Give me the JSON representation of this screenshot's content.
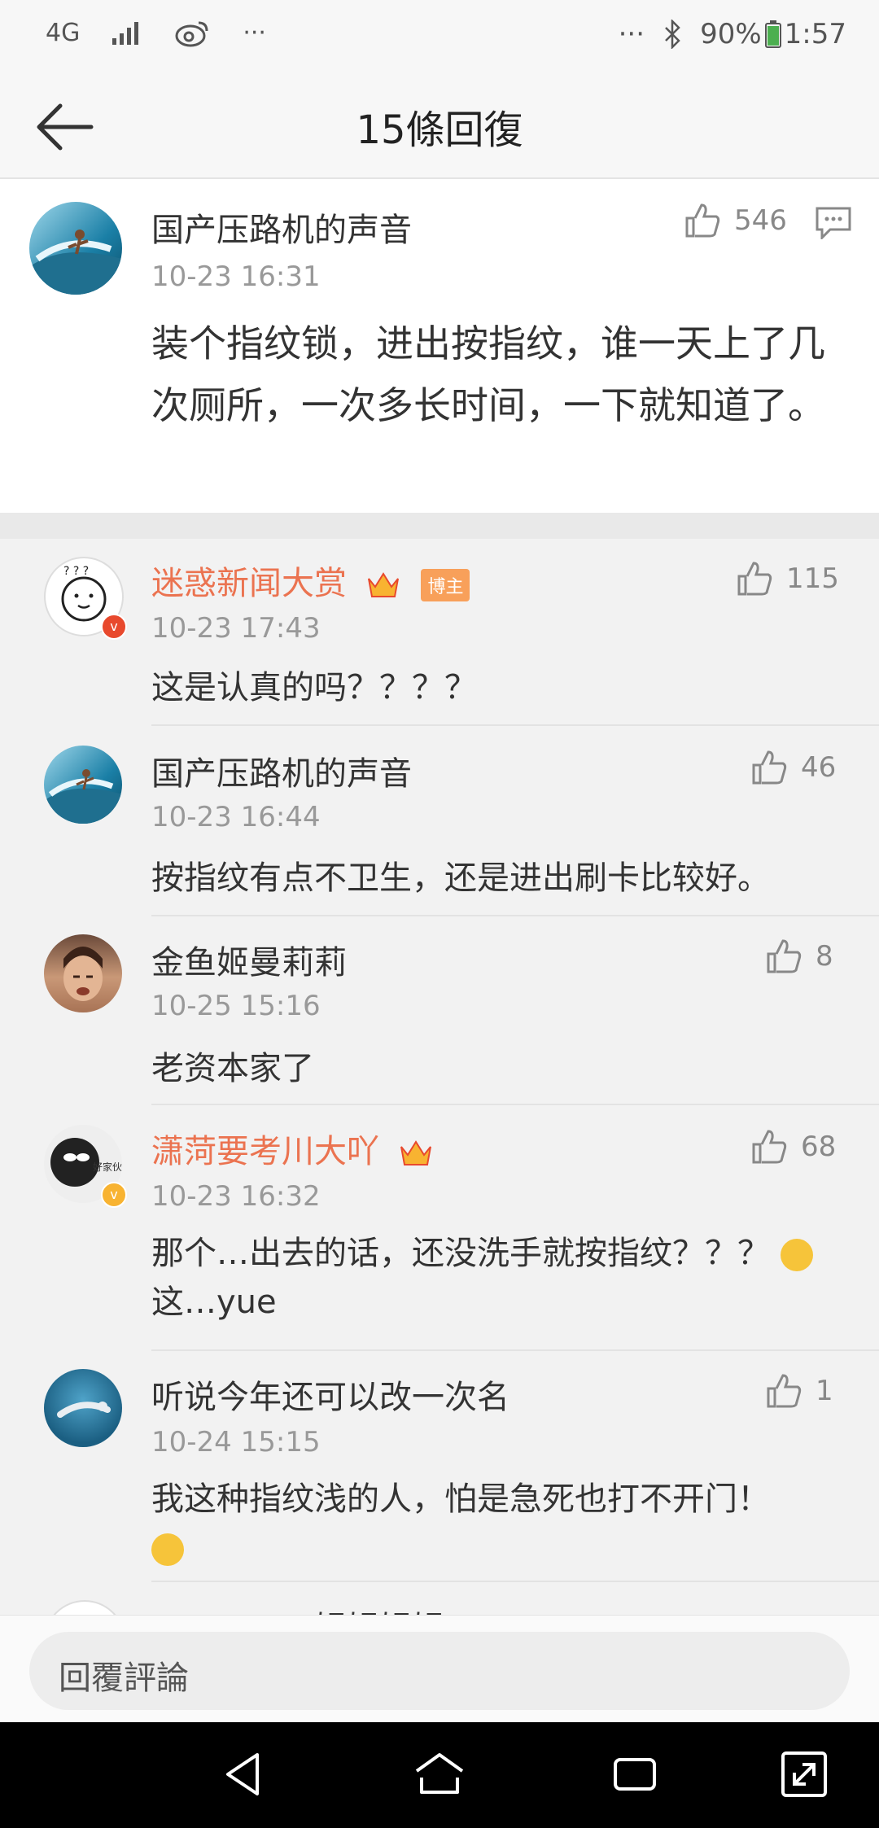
{
  "status_bar": {
    "network": "4G",
    "battery": "90%",
    "time": "1:57"
  },
  "nav": {
    "title": "15條回復"
  },
  "main_comment": {
    "username": "国产压路机的声音",
    "time": "10-23 16:31",
    "likes": "546",
    "text": "装个指纹锁，进出按指纹，谁一天上了几次厕所，一次多长时间，一下就知道了。"
  },
  "replies": [
    {
      "username": "迷惑新闻大赏",
      "time": "10-23 17:43",
      "likes": "115",
      "text": "这是认真的吗？？？？",
      "badge": "博主",
      "verified": true
    },
    {
      "username": "国产压路机的声音",
      "time": "10-23 16:44",
      "likes": "46",
      "text": "按指纹有点不卫生，还是进出刷卡比较好。"
    },
    {
      "username": "金鱼姬曼莉莉",
      "time": "10-25 15:16",
      "likes": "8",
      "text": "老资本家了"
    },
    {
      "username": "潇菏要考川大吖",
      "time": "10-23 16:32",
      "likes": "68",
      "text": "那个…出去的话，还没洗手就按指纹？？？",
      "text2": "这…yue",
      "verified": true
    },
    {
      "username": "听说今年还可以改一次名",
      "time": "10-24 15:15",
      "likes": "1",
      "text": "我这种指纹浅的人，怕是急死也打不开门！"
    },
    {
      "username": "・・・・・娼娼娼娼",
      "time": "",
      "likes": "",
      "text": ""
    }
  ],
  "reply_bar": {
    "placeholder": "回覆評論"
  },
  "colors": {
    "accent_orange": "#eb7350",
    "text": "#333333",
    "muted": "#999999"
  }
}
